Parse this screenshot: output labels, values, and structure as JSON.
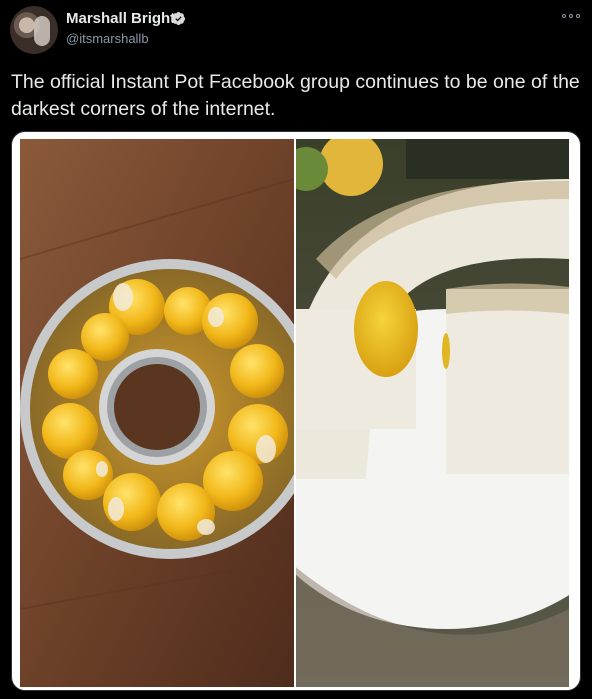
{
  "tweet": {
    "author_name": "Marshall Bright",
    "handle": "@itsmarshallb",
    "text": "The official Instant Pot Facebook group continues to be one of the darkest corners of the internet."
  },
  "icons": {
    "verified": "verified-badge-icon",
    "more": "more-options-icon",
    "avatar": "user-avatar"
  },
  "colors": {
    "background": "#000000",
    "text_primary": "#e7e9ea",
    "text_secondary": "#8b98a5",
    "verified": "#d9d9d9"
  },
  "media": {
    "images": [
      {
        "name": "eggs-in-ring-pan-photo"
      },
      {
        "name": "egg-ring-on-plate-photo"
      }
    ]
  }
}
